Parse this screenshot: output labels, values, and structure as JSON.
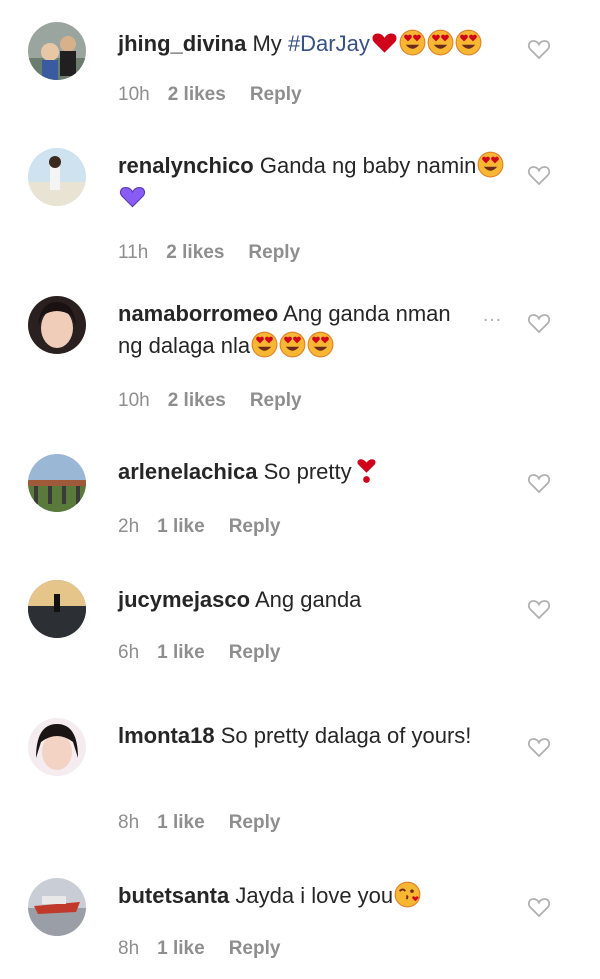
{
  "comments": [
    {
      "user": "jhing_divina",
      "pre": "My ",
      "hashtag": "#DarJay",
      "post": "",
      "emojis": [
        "heart-red-icon",
        "heart-eyes-icon",
        "heart-eyes-icon",
        "heart-eyes-icon"
      ],
      "time": "10h",
      "likes": "2 likes",
      "reply": "Reply"
    },
    {
      "user": "renalynchico",
      "pre": "Ganda ng baby namin",
      "hashtag": "",
      "post": "",
      "emojis": [
        "heart-eyes-icon",
        "purple-heart-icon"
      ],
      "time": "11h",
      "likes": "2 likes",
      "reply": "Reply"
    },
    {
      "user": "namaborromeo",
      "pre": "Ang ganda nman ng dalaga nla",
      "hashtag": "",
      "post": "",
      "emojis": [
        "heart-eyes-icon",
        "heart-eyes-icon",
        "heart-eyes-icon"
      ],
      "time": "10h",
      "likes": "2 likes",
      "reply": "Reply"
    },
    {
      "user": "arlenelachica",
      "pre": "So pretty",
      "hashtag": "",
      "post": "",
      "emojis": [
        "heart-exclamation-icon"
      ],
      "time": "2h",
      "likes": "1 like",
      "reply": "Reply"
    },
    {
      "user": "jucymejasco",
      "pre": "Ang ganda",
      "hashtag": "",
      "post": "",
      "emojis": [],
      "time": "6h",
      "likes": "1 like",
      "reply": "Reply"
    },
    {
      "user": "lmonta18",
      "pre": "So pretty dalaga of yours!",
      "hashtag": "",
      "post": "",
      "emojis": [],
      "time": "8h",
      "likes": "1 like",
      "reply": "Reply"
    },
    {
      "user": "butetsanta",
      "pre": "Jayda i love you",
      "hashtag": "",
      "post": "",
      "emojis": [
        "kissing-heart-icon"
      ],
      "time": "8h",
      "likes": "1 like",
      "reply": "Reply"
    }
  ],
  "colors": {
    "text": "#262626",
    "meta": "#8e8e8e",
    "hashtag": "#385185",
    "emoji_face": "#f7b733",
    "heart_red": "#d0021b"
  }
}
